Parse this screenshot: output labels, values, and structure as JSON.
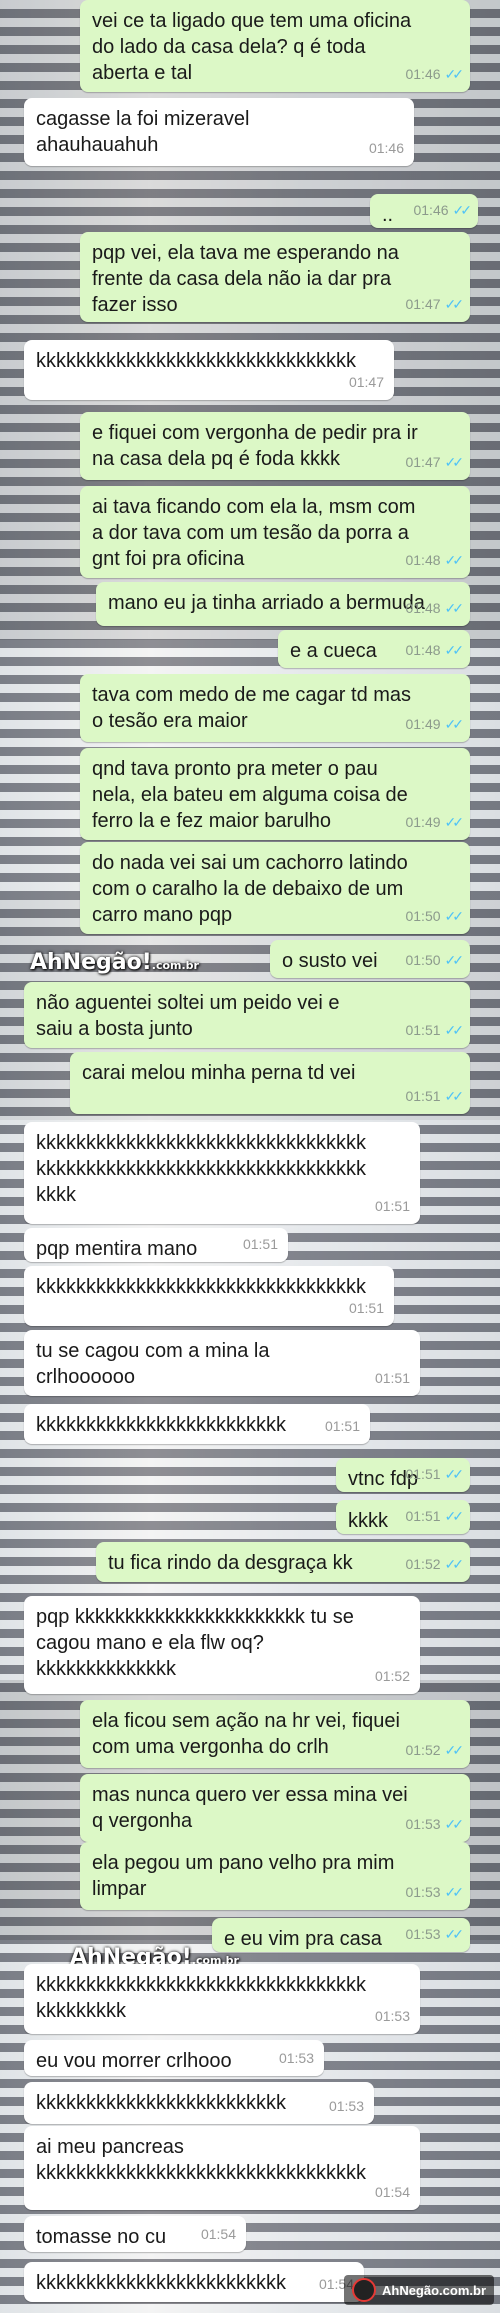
{
  "colors": {
    "outgoing_bubble": "#dcf8c6",
    "incoming_bubble": "#ffffff",
    "read_ticks": "#4fc3f7"
  },
  "icons": {
    "read_receipt": "double-check-icon"
  },
  "watermark": {
    "logo_text": "AhNegão!",
    "logo_sub": ".com.br",
    "footer_text": "AhNegão.com.br"
  },
  "messages": [
    {
      "dir": "out",
      "text": "vei ce ta ligado que tem uma oficina\ndo lado da casa dela? q é toda\naberta e tal",
      "time": "01:46"
    },
    {
      "dir": "in",
      "text": "cagasse la foi mizeravel\nahauhauahuh",
      "time": "01:46"
    },
    {
      "dir": "out",
      "text": "..",
      "time": "01:46"
    },
    {
      "dir": "out",
      "text": "pqp vei, ela tava me esperando na\nfrente da casa dela não ia dar pra\nfazer isso",
      "time": "01:47"
    },
    {
      "dir": "in",
      "text": "kkkkkkkkkkkkkkkkkkkkkkkkkkkkkkkk",
      "time": "01:47"
    },
    {
      "dir": "out",
      "text": "e fiquei com vergonha de pedir pra ir\nna casa dela pq é foda kkkk",
      "time": "01:47"
    },
    {
      "dir": "out",
      "text": "ai tava ficando com ela la, msm com\na dor tava com um tesão da porra a\ngnt foi pra oficina",
      "time": "01:48"
    },
    {
      "dir": "out",
      "text": "mano eu ja tinha arriado a bermuda",
      "time": "01:48"
    },
    {
      "dir": "out",
      "text": "e a cueca",
      "time": "01:48"
    },
    {
      "dir": "out",
      "text": "tava com medo de me cagar td mas\no tesão era maior",
      "time": "01:49"
    },
    {
      "dir": "out",
      "text": "qnd tava pronto pra meter o pau\nnela, ela bateu em alguma coisa de\nferro la e fez maior barulho",
      "time": "01:49"
    },
    {
      "dir": "out",
      "text": "do nada vei sai um cachorro latindo\ncom o caralho la de debaixo de um\ncarro mano pqp",
      "time": "01:50"
    },
    {
      "dir": "out",
      "text": "o susto vei",
      "time": "01:50"
    },
    {
      "dir": "out",
      "text": "não aguentei soltei um peido vei e\nsaiu a bosta junto",
      "time": "01:51"
    },
    {
      "dir": "out",
      "text": "carai melou minha perna td vei",
      "time": "01:51"
    },
    {
      "dir": "in",
      "text": "kkkkkkkkkkkkkkkkkkkkkkkkkkkkkkkkk\nkkkkkkkkkkkkkkkkkkkkkkkkkkkkkkkkk\nkkkk",
      "time": "01:51"
    },
    {
      "dir": "in",
      "text": "pqp mentira mano",
      "time": "01:51"
    },
    {
      "dir": "in",
      "text": "kkkkkkkkkkkkkkkkkkkkkkkkkkkkkkkkk",
      "time": "01:51"
    },
    {
      "dir": "in",
      "text": "tu se cagou com a mina la\ncrlhoooooo",
      "time": "01:51"
    },
    {
      "dir": "in",
      "text": "kkkkkkkkkkkkkkkkkkkkkkkkk",
      "time": "01:51"
    },
    {
      "dir": "out",
      "text": "vtnc fdp",
      "time": "01:51"
    },
    {
      "dir": "out",
      "text": "kkkk",
      "time": "01:51"
    },
    {
      "dir": "out",
      "text": "tu fica rindo da desgraça kk",
      "time": "01:52"
    },
    {
      "dir": "in",
      "text": "pqp kkkkkkkkkkkkkkkkkkkkkkk tu se\ncagou mano e ela flw oq?\nkkkkkkkkkkkkkk",
      "time": "01:52"
    },
    {
      "dir": "out",
      "text": "ela ficou sem ação na hr vei, fiquei\ncom uma vergonha do crlh",
      "time": "01:52"
    },
    {
      "dir": "out",
      "text": "mas nunca quero ver essa mina vei\nq vergonha",
      "time": "01:53"
    },
    {
      "dir": "out",
      "text": "ela pegou um pano velho pra mim\nlimpar",
      "time": "01:53"
    },
    {
      "dir": "out",
      "text": "e eu vim pra casa",
      "time": "01:53"
    },
    {
      "dir": "in",
      "text": "kkkkkkkkkkkkkkkkkkkkkkkkkkkkkkkkk\nkkkkkkkkk",
      "time": "01:53"
    },
    {
      "dir": "in",
      "text": "eu vou morrer crlhooo",
      "time": "01:53"
    },
    {
      "dir": "in",
      "text": "kkkkkkkkkkkkkkkkkkkkkkkkk",
      "time": "01:53"
    },
    {
      "dir": "in",
      "text": "ai meu pancreas\nkkkkkkkkkkkkkkkkkkkkkkkkkkkkkkkkk",
      "time": "01:54"
    },
    {
      "dir": "in",
      "text": "tomasse no cu",
      "time": "01:54"
    },
    {
      "dir": "in",
      "text": "kkkkkkkkkkkkkkkkkkkkkkkkk",
      "time": "01:54"
    }
  ]
}
